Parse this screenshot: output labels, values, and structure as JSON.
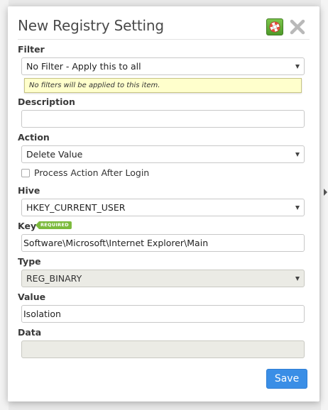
{
  "dialog": {
    "title": "New Registry Setting",
    "help_icon": "lifebuoy-icon",
    "close_icon": "close-icon"
  },
  "filter": {
    "label": "Filter",
    "value": "No Filter - Apply this to all",
    "note": "No filters will be applied to this item."
  },
  "description": {
    "label": "Description",
    "value": ""
  },
  "action": {
    "label": "Action",
    "value": "Delete Value",
    "checkbox_label": "Process Action After Login",
    "checkbox_checked": false
  },
  "hive": {
    "label": "Hive",
    "value": "HKEY_CURRENT_USER"
  },
  "key": {
    "label": "Key",
    "badge": "REQUIRED",
    "value": "Software\\Microsoft\\Internet Explorer\\Main"
  },
  "type": {
    "label": "Type",
    "value": "REG_BINARY"
  },
  "value": {
    "label": "Value",
    "value": "Isolation"
  },
  "data": {
    "label": "Data",
    "value": ""
  },
  "footer": {
    "save_label": "Save"
  },
  "colors": {
    "accent": "#3a8ee6",
    "required_badge": "#7cba3d",
    "note_bg": "#ffffcc"
  }
}
